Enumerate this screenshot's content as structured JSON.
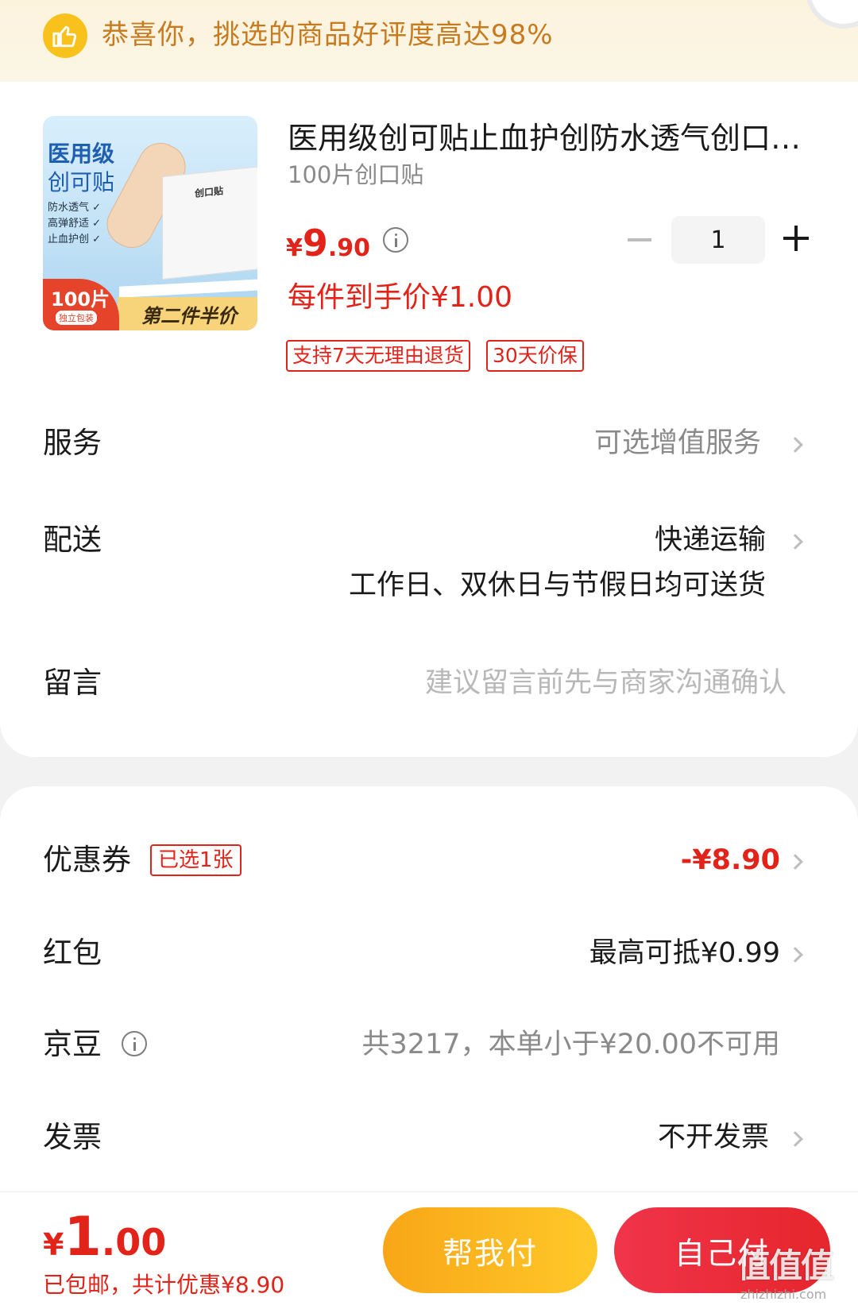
{
  "banner": {
    "text": "恭喜你，挑选的商品好评度高达98%"
  },
  "product": {
    "image": {
      "line1": "医用级",
      "line2": "创可贴",
      "features": [
        "防水透气 ✓",
        "高弹舒适 ✓",
        "止血护创 ✓"
      ],
      "box_label": "创口贴",
      "badge_count": "100片",
      "badge_sub": "独立包装",
      "promo": "第二件半价"
    },
    "title": "医用级创可贴止血护创防水透气创口…",
    "spec": "100片创口贴",
    "price": {
      "currency": "¥",
      "integer": "9",
      "decimal": ".90"
    },
    "quantity": "1",
    "unit_price": "每件到手价¥1.00",
    "tags": [
      "支持7天无理由退货",
      "30天价保"
    ]
  },
  "rows": {
    "service": {
      "label": "服务",
      "value": "可选增值服务"
    },
    "delivery": {
      "label": "配送",
      "value": "快递运输",
      "sub": "工作日、双休日与节假日均可送货"
    },
    "message": {
      "label": "留言",
      "placeholder": "建议留言前先与商家沟通确认"
    },
    "coupon": {
      "label": "优惠券",
      "tag": "已选1张",
      "value": "-¥8.90"
    },
    "redpack": {
      "label": "红包",
      "value": "最高可抵¥0.99"
    },
    "jingdou": {
      "label": "京豆",
      "value": "共3217，本单小于¥20.00不可用"
    },
    "invoice": {
      "label": "发票",
      "value": "不开发票"
    }
  },
  "footer": {
    "total": {
      "currency": "¥",
      "integer": "1",
      "decimal": ".00"
    },
    "sub": "已包邮，共计优惠¥8.90",
    "help_pay": "帮我付",
    "self_pay": "自己付",
    "watermark": "值值值",
    "watermark_url": "zhizhizhi.com"
  },
  "colors": {
    "accent_red": "#e2231a",
    "banner_text": "#c77a1e",
    "help_button": "#f8a617",
    "self_button": "#e6262c"
  }
}
